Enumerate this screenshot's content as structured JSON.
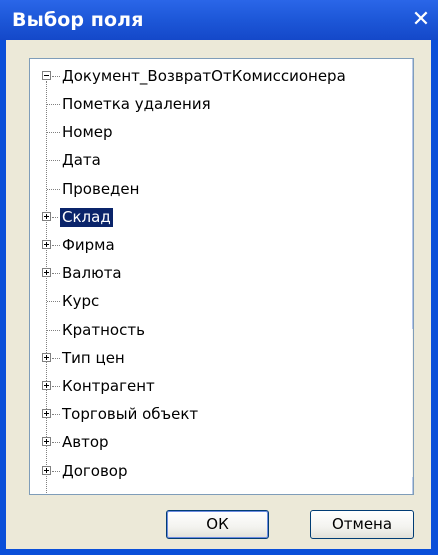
{
  "window": {
    "title": "Выбор поля",
    "close_glyph": "✕",
    "title_bar_color": "#1d57d8",
    "accent_color": "#0a246a"
  },
  "tree": {
    "root_label": "Документ_ВозвратОтКомиссионера",
    "items": [
      {
        "label": "Пометка удаления",
        "expandable": false,
        "selected": false
      },
      {
        "label": "Номер",
        "expandable": false,
        "selected": false
      },
      {
        "label": "Дата",
        "expandable": false,
        "selected": false
      },
      {
        "label": "Проведен",
        "expandable": false,
        "selected": false
      },
      {
        "label": "Склад",
        "expandable": true,
        "selected": true
      },
      {
        "label": "Фирма",
        "expandable": true,
        "selected": false
      },
      {
        "label": "Валюта",
        "expandable": true,
        "selected": false
      },
      {
        "label": "Курс",
        "expandable": false,
        "selected": false
      },
      {
        "label": "Кратность",
        "expandable": false,
        "selected": false
      },
      {
        "label": "Тип цен",
        "expandable": true,
        "selected": false
      },
      {
        "label": "Контрагент",
        "expandable": true,
        "selected": false
      },
      {
        "label": "Торговый объект",
        "expandable": true,
        "selected": false
      },
      {
        "label": "Автор",
        "expandable": true,
        "selected": false
      },
      {
        "label": "Договор",
        "expandable": true,
        "selected": false
      }
    ],
    "scroll_position": 0
  },
  "scrollbar": {
    "up_icon": "scroll-up-arrow",
    "down_icon": "scroll-down-arrow",
    "up_glyph": "▲",
    "down_glyph": "▼"
  },
  "buttons": {
    "ok_label": "ОК",
    "cancel_label": "Отмена"
  }
}
